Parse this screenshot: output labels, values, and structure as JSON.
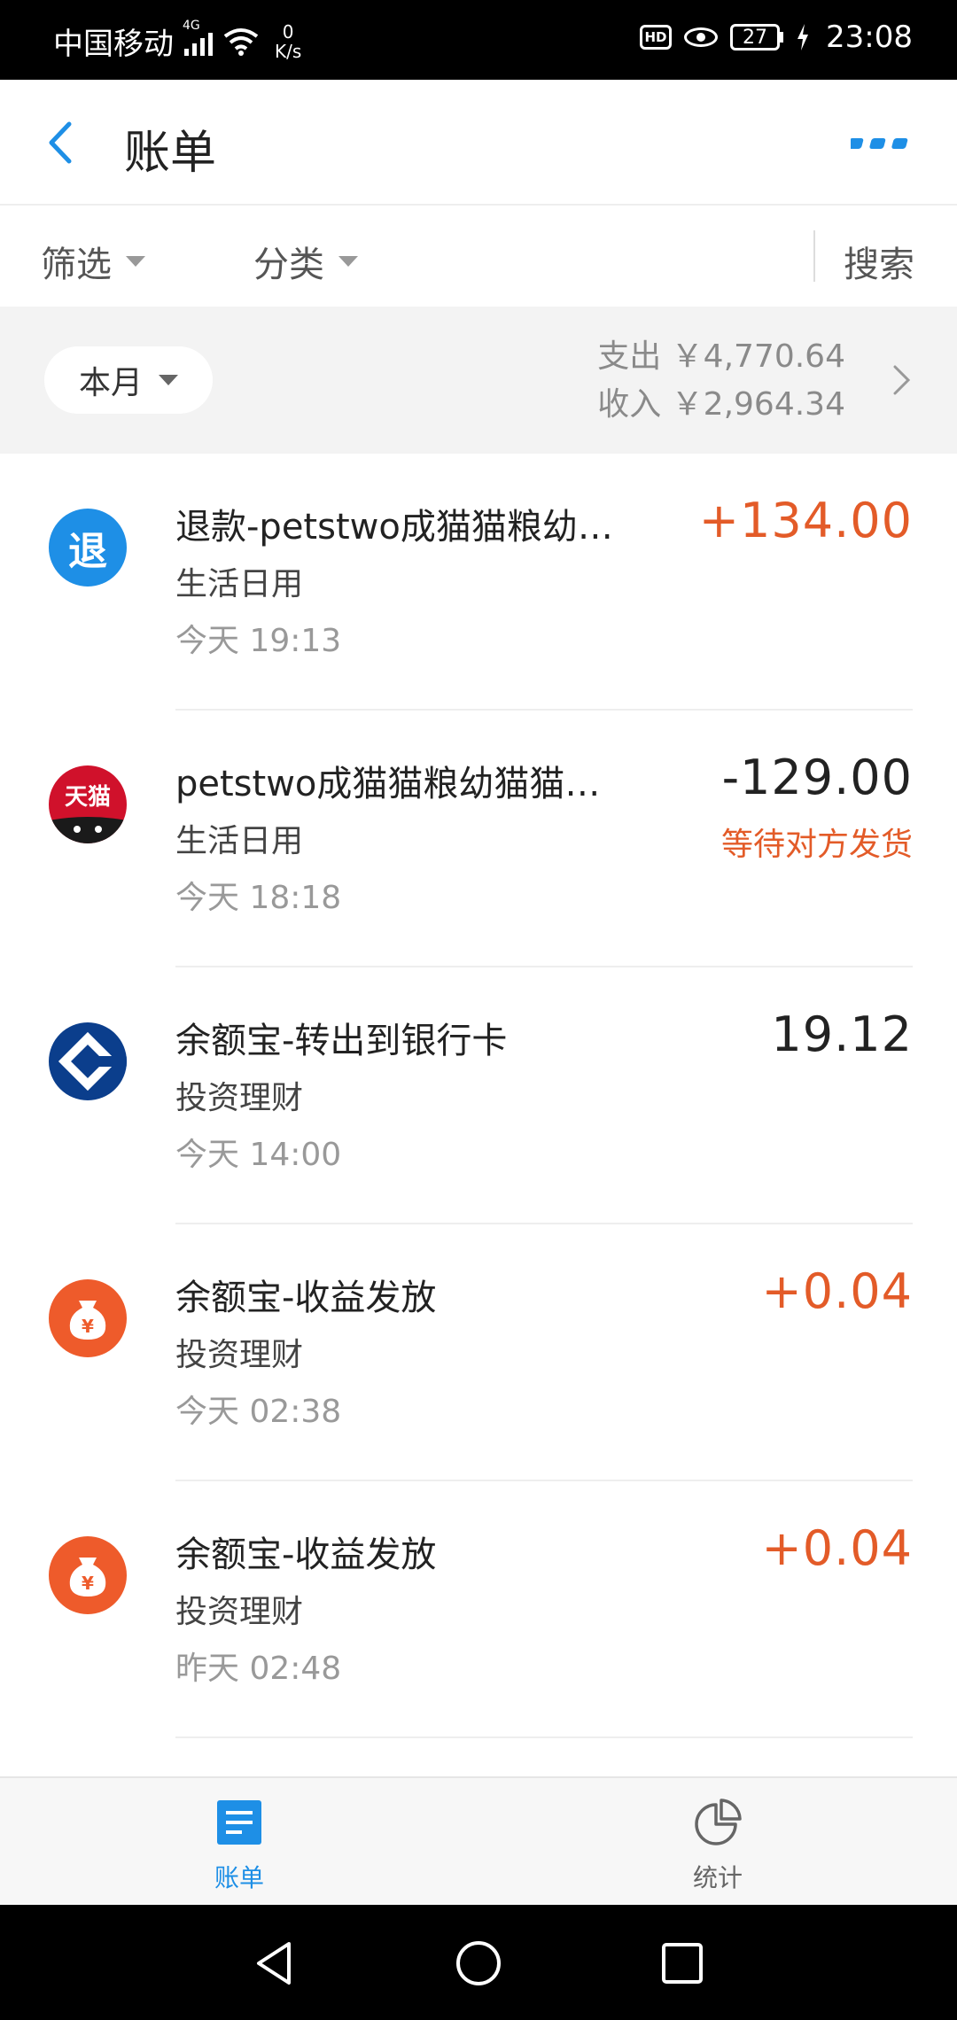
{
  "status_bar": {
    "carrier": "中国移动",
    "network": "4G",
    "speed_value": "0",
    "speed_unit": "K/s",
    "hd": "HD",
    "battery": "27",
    "time": "23:08"
  },
  "header": {
    "title": "账单"
  },
  "filters": {
    "filter_label": "筛选",
    "category_label": "分类",
    "search_label": "搜索"
  },
  "summary": {
    "month_label": "本月",
    "expense": "支出 ￥4,770.64",
    "income": "收入 ￥2,964.34"
  },
  "transactions": [
    {
      "icon_char": "退",
      "name": "退款-petstwo成猫猫粮幼…",
      "category": "生活日用",
      "time": "今天  19:13",
      "amount": "+134.00",
      "status": ""
    },
    {
      "icon_char": "天猫",
      "name": "petstwo成猫猫粮幼猫猫…",
      "category": "生活日用",
      "time": "今天  18:18",
      "amount": "-129.00",
      "status": "等待对方发货"
    },
    {
      "icon_char": "",
      "name": "余额宝-转出到银行卡",
      "category": "投资理财",
      "time": "今天  14:00",
      "amount": "19.12",
      "status": ""
    },
    {
      "icon_char": "¥",
      "name": "余额宝-收益发放",
      "category": "投资理财",
      "time": "今天  02:38",
      "amount": "+0.04",
      "status": ""
    },
    {
      "icon_char": "¥",
      "name": "余额宝-收益发放",
      "category": "投资理财",
      "time": "昨天  02:48",
      "amount": "+0.04",
      "status": ""
    }
  ],
  "tabs": {
    "bill": "账单",
    "stats": "统计"
  },
  "colors": {
    "accent": "#1e8fe6",
    "positive": "#e35b28"
  }
}
